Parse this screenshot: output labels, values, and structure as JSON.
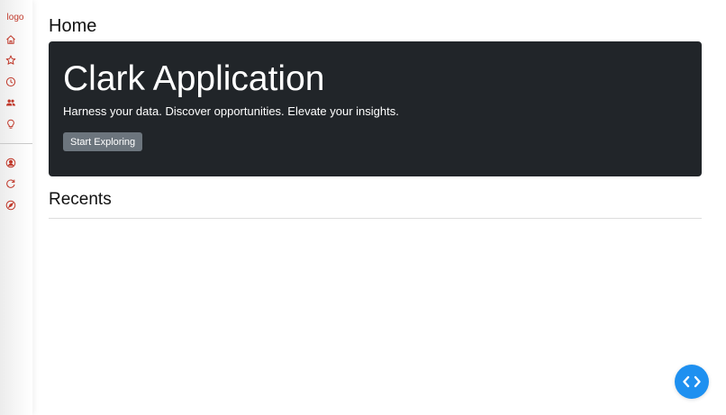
{
  "colors": {
    "accent": "#c0392b",
    "hero_bg": "#212529",
    "button_bg": "#6c757d",
    "fab_bg": "#1e90f0"
  },
  "sidebar": {
    "logo": "logo",
    "top_icons": [
      "home-icon",
      "star-icon",
      "clock-icon",
      "users-icon",
      "lightbulb-icon"
    ],
    "bottom_icons": [
      "user-circle-icon",
      "refresh-icon",
      "compass-icon"
    ]
  },
  "page": {
    "title": "Home"
  },
  "hero": {
    "title": "Clark Application",
    "subtitle": "Harness your data. Discover opportunities. Elevate your insights.",
    "button_label": "Start Exploring"
  },
  "recents": {
    "title": "Recents"
  },
  "fab": {
    "icon": "code-icon"
  }
}
